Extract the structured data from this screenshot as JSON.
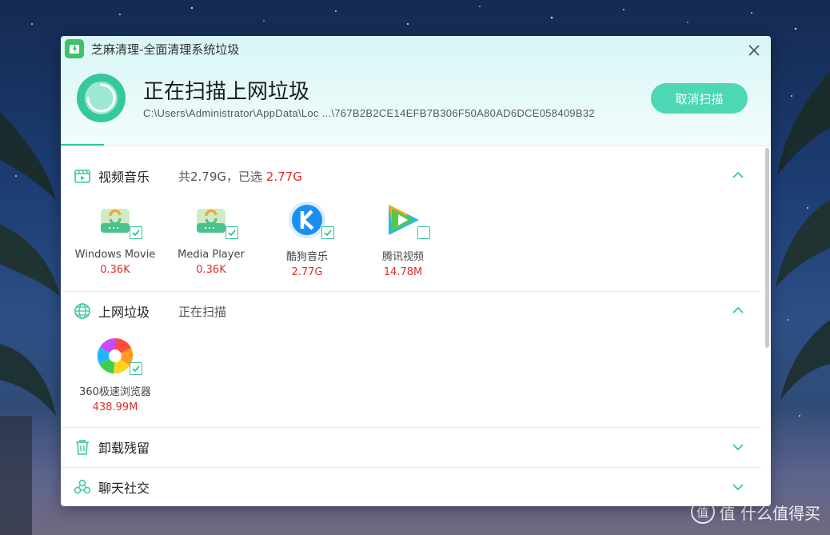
{
  "window": {
    "title": "芝麻清理-全面清理系统垃圾",
    "scan_title": "正在扫描上网垃圾",
    "scan_path": "C:\\Users\\Administrator\\AppData\\Loc ...\\767B2B2CE14EFB7B306F50A80AD6DCE058409B32",
    "cancel_label": "取消扫描"
  },
  "sections": [
    {
      "label": "视频音乐",
      "summary_prefix": "共2.79G，已选 ",
      "summary_selected": "2.77G",
      "expanded": true,
      "items": [
        {
          "name": "Windows Movie",
          "size": "0.36K",
          "checked": true,
          "icon": "windows-movie-icon"
        },
        {
          "name": "Media Player",
          "size": "0.36K",
          "checked": true,
          "icon": "media-player-icon"
        },
        {
          "name": "酷狗音乐",
          "size": "2.77G",
          "checked": true,
          "icon": "kugou-icon"
        },
        {
          "name": "腾讯视频",
          "size": "14.78M",
          "checked": false,
          "icon": "tencent-video-icon"
        }
      ]
    },
    {
      "label": "上网垃圾",
      "summary": "正在扫描",
      "expanded": true,
      "items": [
        {
          "name": "360极速浏览器",
          "size": "438.99M",
          "checked": true,
          "icon": "360-browser-icon"
        }
      ]
    },
    {
      "label": "卸载残留",
      "expanded": false
    },
    {
      "label": "聊天社交",
      "expanded": false
    }
  ],
  "watermark": "值 什么值得买",
  "colors": {
    "accent": "#36c79c",
    "button": "#4ed7b4",
    "size_red": "#e02a2a"
  }
}
